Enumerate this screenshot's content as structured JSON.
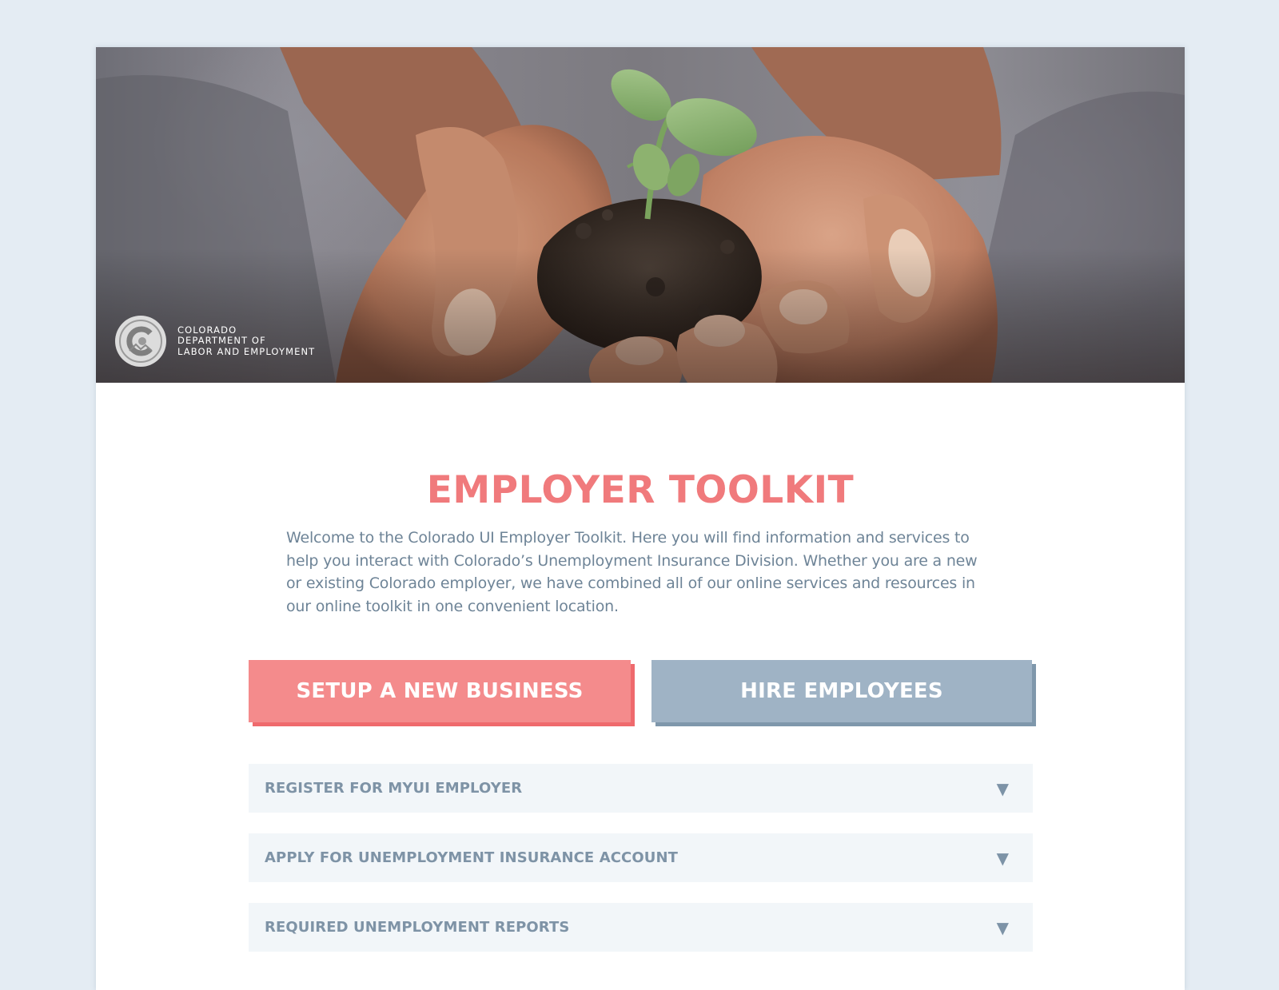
{
  "header": {
    "logo_lines": [
      "COLORADO",
      "DEPARTMENT OF",
      "LABOR  AND  EMPLOYMENT"
    ]
  },
  "main": {
    "title": "EMPLOYER TOOLKIT",
    "intro_lines": [
      "Welcome to the Colorado UI Employer Toolkit. Here you will find information and services to",
      "help you interact with Colorado’s Unemployment Insurance Division. Whether you are a new",
      "or existing Colorado employer, we have combined all of our online services and resources in",
      "our online toolkit in one convenient location."
    ],
    "buttons": {
      "setup_label": "SETUP A NEW BUSINESS",
      "hire_label": "HIRE EMPLOYEES"
    },
    "accordion": [
      {
        "label": "REGISTER FOR MYUI EMPLOYER",
        "icon": "triangle-down-icon"
      },
      {
        "label": "APPLY FOR UNEMPLOYMENT INSURANCE ACCOUNT",
        "icon": "triangle-down-icon"
      },
      {
        "label": "REQUIRED UNEMPLOYMENT REPORTS",
        "icon": "triangle-down-icon"
      }
    ],
    "arrow_glyph": "▼"
  },
  "colors": {
    "page_background": "#e4ecf3",
    "title": "#f07a7c",
    "body_text": "#6e8497",
    "setup_button": "#f48b8c",
    "hire_button": "#9fb3c5",
    "accordion_background": "#f2f6f9",
    "accordion_text": "#7e93a6"
  }
}
